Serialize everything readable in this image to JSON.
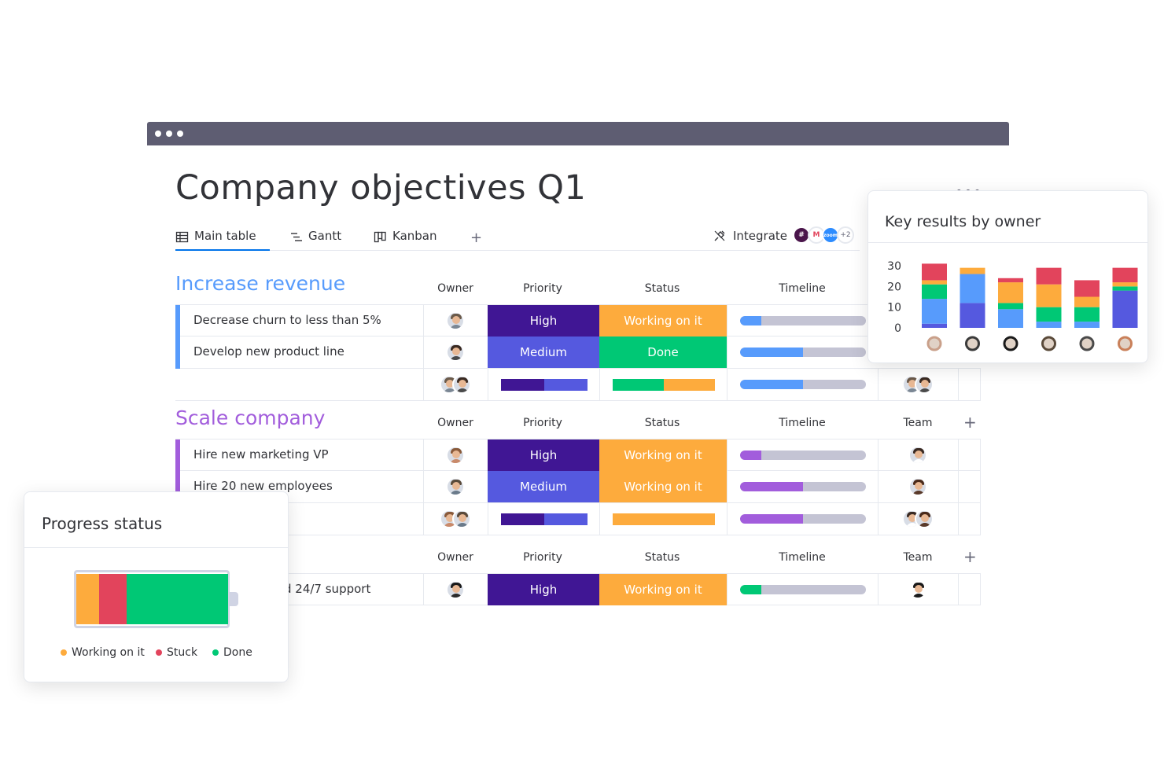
{
  "page": {
    "title": "Company objectives Q1"
  },
  "tabs": [
    {
      "label": "Main table",
      "icon": "table-icon"
    },
    {
      "label": "Gantt",
      "icon": "gantt-icon"
    },
    {
      "label": "Kanban",
      "icon": "kanban-icon"
    }
  ],
  "tab_add": "+",
  "integrate": {
    "label": "Integrate",
    "extra_count": "+2",
    "logo_text": "zoom"
  },
  "columns": {
    "owner": "Owner",
    "priority": "Priority",
    "status": "Status",
    "timeline": "Timeline",
    "team": "Team"
  },
  "colors": {
    "high": "#401694",
    "medium": "#5559df",
    "working": "#fdab3d",
    "done": "#00c875",
    "stuck": "#e2445c",
    "blue_group": "#579bfc",
    "purple_group": "#a25ddc",
    "green_group": "#00c875"
  },
  "groups": [
    {
      "title": "Increase revenue",
      "rows": [
        {
          "name": "Decrease churn to less than 5%",
          "priority": "High",
          "status": "Working on it",
          "timeline_progress": 0.17
        },
        {
          "name": "Develop new product line",
          "priority": "Medium",
          "status": "Done",
          "timeline_progress": 0.5
        }
      ],
      "summary": {
        "timeline_progress": 0.5
      }
    },
    {
      "title": "Scale company",
      "rows": [
        {
          "name": "Hire new marketing VP",
          "priority": "High",
          "status": "Working on it",
          "timeline_progress": 0.17
        },
        {
          "name": "Hire 20 new employees",
          "priority": "Medium",
          "status": "Working on it",
          "timeline_progress": 0.5
        }
      ],
      "summary": {
        "timeline_progress": 0.5
      }
    },
    {
      "title": "",
      "rows": [
        {
          "name": "d 24/7 support",
          "priority": "High",
          "status": "Working on it",
          "timeline_progress": 0.17
        }
      ]
    }
  ],
  "add_column": "+",
  "key_results_card": {
    "title": "Key results by owner",
    "chart_data": {
      "type": "bar",
      "stacked": true,
      "yticks": [
        "30",
        "20",
        "10",
        "0"
      ],
      "ylim": [
        0,
        30
      ],
      "categories": [
        "",
        "",
        "",
        "",
        "",
        ""
      ],
      "series": [
        {
          "color": "#5559df",
          "values": [
            2,
            12,
            0,
            0,
            0,
            18
          ]
        },
        {
          "color": "#579bfc",
          "values": [
            12,
            14,
            9,
            3,
            3,
            0
          ]
        },
        {
          "color": "#00c875",
          "values": [
            7,
            0,
            3,
            7,
            7,
            2
          ]
        },
        {
          "color": "#fdab3d",
          "values": [
            2,
            3,
            10,
            11,
            5,
            2
          ]
        },
        {
          "color": "#e2445c",
          "values": [
            8,
            0,
            2,
            8,
            8,
            7
          ]
        }
      ]
    }
  },
  "progress_card": {
    "title": "Progress status",
    "battery": {
      "working": 0.15,
      "stuck": 0.18,
      "done": 0.67
    },
    "legend": [
      "Working on it",
      "Stuck",
      "Done"
    ]
  }
}
